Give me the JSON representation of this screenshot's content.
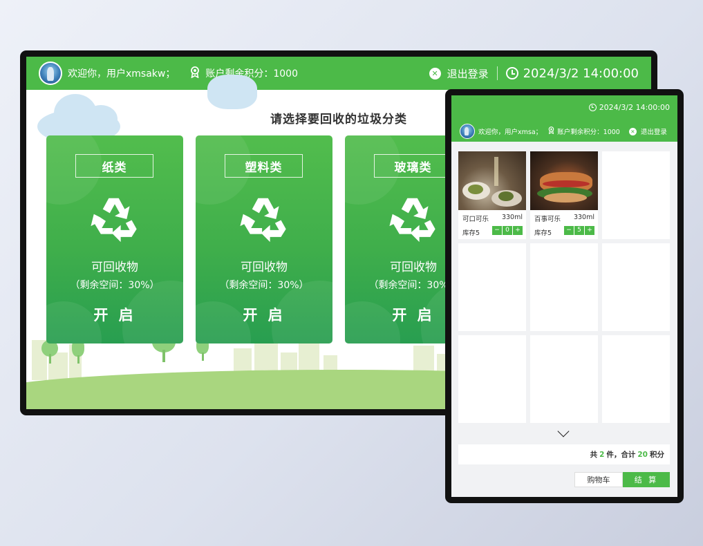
{
  "big_screen": {
    "header": {
      "welcome": "欢迎你，用户xmsakw；",
      "points": "账户剩余积分：1000",
      "logout": "退出登录",
      "datetime": "2024/3/2 14:00:00"
    },
    "prompt": "请选择要回收的垃圾分类",
    "cards": [
      {
        "title": "纸类",
        "subtitle": "可回收物",
        "space": "（剩余空间：30%）",
        "action": "开 启"
      },
      {
        "title": "塑料类",
        "subtitle": "可回收物",
        "space": "（剩余空间：30%）",
        "action": "开 启"
      },
      {
        "title": "玻璃类",
        "subtitle": "可回收物",
        "space": "（剩余空间：30%）",
        "action": "开 启"
      }
    ]
  },
  "tablet": {
    "datetime": "2024/3/2 14:00:00",
    "welcome": "欢迎你，用户xmsa；",
    "points": "账户剩余积分：1000",
    "logout": "退出登录",
    "products": [
      {
        "name": "可口可乐",
        "volume": "330ml",
        "stock": "库存5",
        "qty": "0"
      },
      {
        "name": "百事可乐",
        "volume": "330ml",
        "stock": "库存5",
        "qty": "5"
      }
    ],
    "stepper": {
      "minus": "−",
      "plus": "+"
    },
    "total": {
      "prefix": "共",
      "count": "2",
      "mid": "件，合计",
      "points": "20",
      "suffix": "积分"
    },
    "cart_button": "购物车",
    "pay_button": "结 算"
  },
  "colors": {
    "brand_green": "#4cba48",
    "hill_green": "#a9d67f"
  },
  "icons": [
    "avatar",
    "medal-icon",
    "close-icon",
    "clock-icon",
    "recycle-icon",
    "chevron-down-icon"
  ]
}
